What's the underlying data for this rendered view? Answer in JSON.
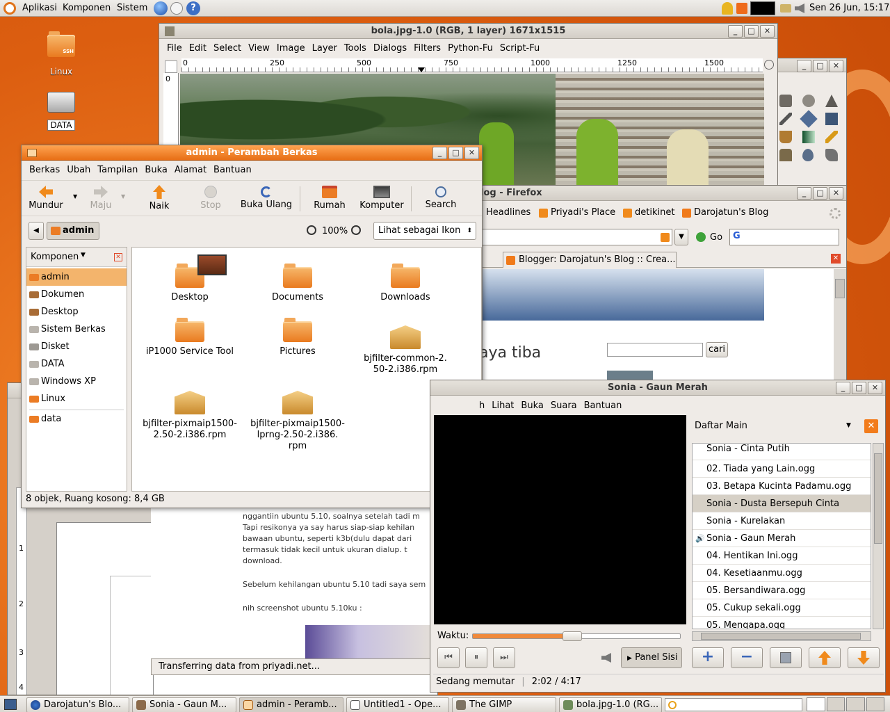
{
  "top_panel": {
    "menus": [
      "Aplikasi",
      "Komponen",
      "Sistem"
    ],
    "clock": "Sen 26 Jun, 15:17"
  },
  "desktop_icons": [
    {
      "label": "Linux",
      "badge": "SSH"
    },
    {
      "label": "DATA"
    }
  ],
  "gimp": {
    "title": "bola.jpg-1.0 (RGB, 1 layer) 1671x1515",
    "menu": [
      "File",
      "Edit",
      "Select",
      "View",
      "Image",
      "Layer",
      "Tools",
      "Dialogs",
      "Filters",
      "Python-Fu",
      "Script-Fu"
    ],
    "ruler_ticks": [
      "0",
      "250",
      "500",
      "750",
      "1000",
      "1250",
      "1500"
    ],
    "vruler_tick": "0"
  },
  "firefox": {
    "title": "log - Firefox",
    "bookmarks": [
      "Headlines",
      "Priyadi's Place",
      "detikinet",
      "Darojatun's Blog"
    ],
    "go_label": "Go",
    "search_engine": "G",
    "tab": "Blogger: Darojatun's Blog :: Crea...",
    "page_heading": "aya tiba",
    "search_button": "cari"
  },
  "writer": {
    "text_lines": [
      "nggantiin ubuntu 5.10, soalnya setelah tadi m",
      "Tapi resikonya ya say harus siap-siap kehilan",
      "bawaan ubuntu, seperti k3b(dulu dapat dari",
      "termasuk tidak kecil untuk ukuran dialup. t",
      "download.",
      "Sebelum kehilangan ubuntu 5.10 tadi saya sem",
      "nih screenshot ubuntu 5.10ku :"
    ],
    "status": "Transferring data from priyadi.net...",
    "ruler_numbers": [
      "1",
      "2",
      "3",
      "4"
    ]
  },
  "nautilus": {
    "title": "admin - Perambah Berkas",
    "menu": [
      "Berkas",
      "Ubah",
      "Tampilan",
      "Buka",
      "Alamat",
      "Bantuan"
    ],
    "toolbar": [
      "Mundur",
      "Maju",
      "Naik",
      "Stop",
      "Buka Ulang",
      "Rumah",
      "Komputer",
      "Search"
    ],
    "location": "admin",
    "zoom": "100%",
    "view_mode": "Lihat sebagai Ikon",
    "side_header": "Komponen",
    "places": [
      "admin",
      "Dokumen",
      "Desktop",
      "Sistem Berkas",
      "Disket",
      "DATA",
      "Windows XP",
      "Linux",
      "data"
    ],
    "files": [
      {
        "label": "Desktop",
        "type": "folder"
      },
      {
        "label": "Documents",
        "type": "folder"
      },
      {
        "label": "Downloads",
        "type": "folder"
      },
      {
        "label": "iP1000 Service Tool",
        "type": "folder"
      },
      {
        "label": "Pictures",
        "type": "folder"
      },
      {
        "label": "bjfilter-common-2.\n50-2.i386.rpm",
        "type": "package"
      },
      {
        "label": "bjfilter-pixmaip1500-\n2.50-2.i386.rpm",
        "type": "package"
      },
      {
        "label": "bjfilter-pixmaip1500-\nlprng-2.50-2.i386.\nrpm",
        "type": "package"
      }
    ],
    "status": "8 objek, Ruang kosong: 8,4 GB"
  },
  "totem": {
    "title": "Sonia - Gaun Merah",
    "menu": [
      "h",
      "Lihat",
      "Buka",
      "Suara",
      "Bantuan"
    ],
    "sidebar_title": "Daftar Main",
    "playlist": [
      "Sonia - Cinta Putih",
      "02. Tiada yang Lain.ogg",
      "03. Betapa Kucinta Padamu.ogg",
      "Sonia - Dusta Bersepuh Cinta",
      "Sonia - Kurelakan",
      "Sonia - Gaun Merah",
      "04. Hentikan Ini.ogg",
      "04. Kesetiaanmu.ogg",
      "05. Bersandiwara.ogg",
      "05. Cukup sekali.ogg",
      "05. Mengapa.ogg"
    ],
    "playing_index": 5,
    "selected_index": 3,
    "waktu_label": "Waktu:",
    "progress": 0.48,
    "panel_button": "Panel Sisi",
    "status": "Sedang memutar",
    "time": "2:02 / 4:17"
  },
  "taskbar": [
    "Darojatun's Blo...",
    "Sonia - Gaun M...",
    "admin - Peramb...",
    "Untitled1 - Ope...",
    "The GIMP",
    "bola.jpg-1.0 (RG..."
  ],
  "colors": {
    "accent": "#e76e15",
    "selected_row": "#d6d0c6",
    "panel": "#e9e6e1"
  }
}
